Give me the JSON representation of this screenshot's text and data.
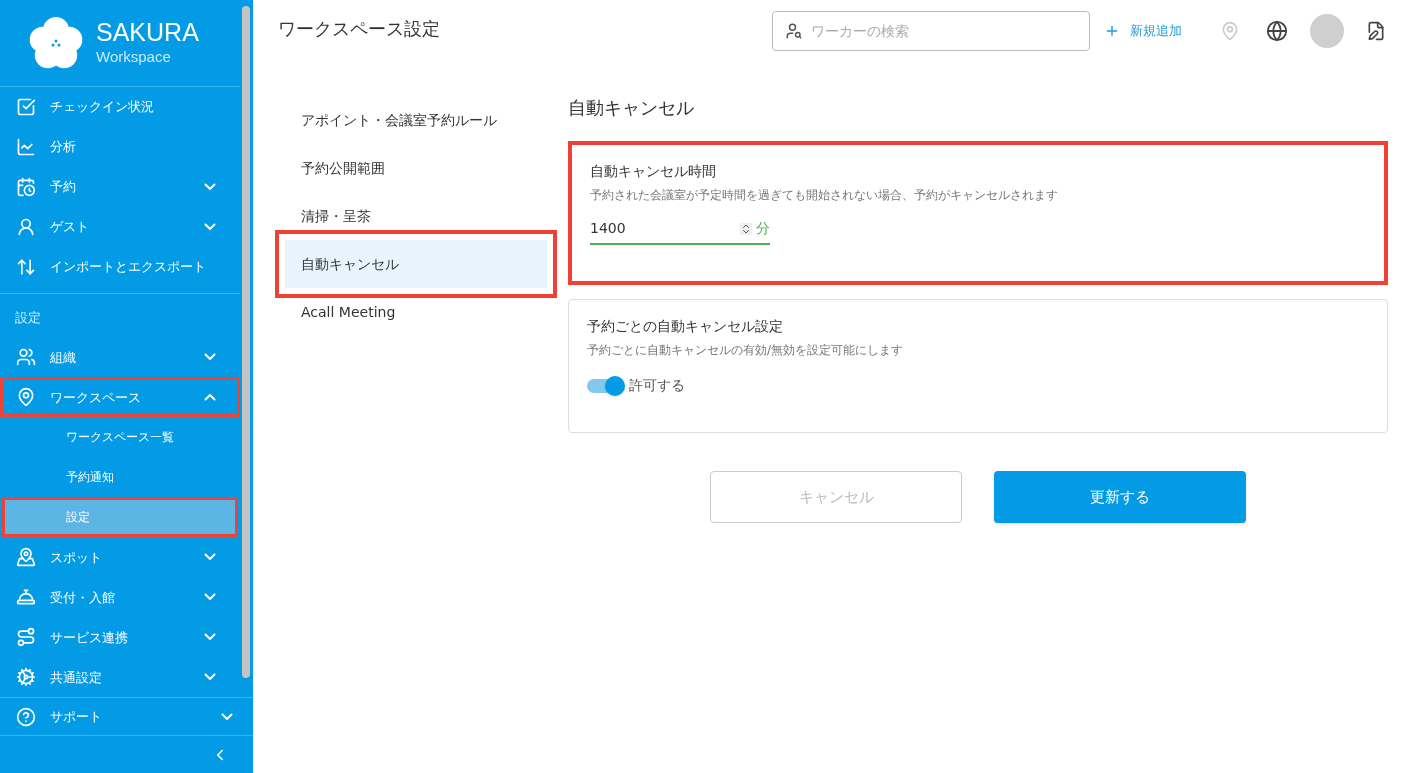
{
  "logo": {
    "name": "SAKURA",
    "subtitle": "Workspace"
  },
  "sidebar": {
    "items": [
      {
        "label": "チェックイン状況",
        "highlighted": false
      },
      {
        "label": "分析",
        "highlighted": false
      },
      {
        "label": "予約",
        "expanded": false,
        "highlighted": false
      },
      {
        "label": "ゲスト",
        "expanded": false,
        "highlighted": false
      },
      {
        "label": "インポートとエクスポート",
        "highlighted": false
      }
    ],
    "section_label": "設定",
    "settings_items": [
      {
        "label": "組織",
        "expanded": false,
        "highlighted": false
      },
      {
        "label": "ワークスペース",
        "expanded": true,
        "highlighted": true,
        "children": [
          {
            "label": "ワークスペース一覧",
            "selected": false,
            "highlighted": false
          },
          {
            "label": "予約通知",
            "selected": false,
            "highlighted": false
          },
          {
            "label": "設定",
            "selected": true,
            "highlighted": true
          }
        ]
      },
      {
        "label": "スポット",
        "expanded": false,
        "highlighted": false
      },
      {
        "label": "受付・入館",
        "expanded": false,
        "highlighted": false
      },
      {
        "label": "サービス連携",
        "expanded": false,
        "highlighted": false
      },
      {
        "label": "共通設定",
        "expanded": false,
        "highlighted": false
      }
    ],
    "support": {
      "label": "サポート",
      "expanded": false
    }
  },
  "header": {
    "title": "ワークスペース設定",
    "search": {
      "placeholder": "ワーカーの検索"
    },
    "add_label": "新規追加"
  },
  "settings_menu": [
    {
      "label": "アポイント・会議室予約ルール",
      "selected": false,
      "highlighted": false
    },
    {
      "label": "予約公開範囲",
      "selected": false,
      "highlighted": false
    },
    {
      "label": "清掃・呈茶",
      "selected": false,
      "highlighted": false
    },
    {
      "label": "自動キャンセル",
      "selected": true,
      "highlighted": true
    },
    {
      "label": "Acall Meeting",
      "selected": false,
      "highlighted": false
    }
  ],
  "section_title": "自動キャンセル",
  "cards": [
    {
      "kind": "number",
      "title": "自動キャンセル時間",
      "description": "予約された会議室が予定時間を過ぎても開始されない場合、予約がキャンセルされます",
      "value": "1400",
      "unit": "分",
      "highlighted": true
    },
    {
      "kind": "toggle",
      "title": "予約ごとの自動キャンセル設定",
      "description": "予約ごとに自動キャンセルの有効/無効を設定可能にします",
      "toggle_label": "許可する",
      "on": true,
      "highlighted": false
    }
  ],
  "buttons": [
    {
      "label": "キャンセル",
      "kind": "secondary"
    },
    {
      "label": "更新する",
      "kind": "primary"
    }
  ]
}
